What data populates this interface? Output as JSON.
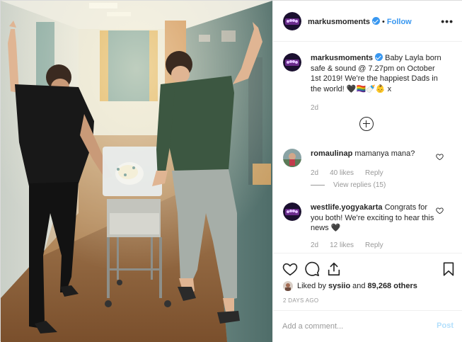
{
  "post": {
    "username": "markusmoments",
    "follow_label": "Follow",
    "more_label": "•••",
    "dot": "•",
    "caption": "Baby Layla born safe & sound @ 7.27pm on October 1st 2019! We're the happiest Dads in the world! 🖤🏳️‍🌈🍼👶 x",
    "caption_time": "2d"
  },
  "comments": [
    {
      "username": "romaulinap",
      "text": "mamanya mana?",
      "time": "2d",
      "likes": "40 likes",
      "reply_label": "Reply",
      "view_replies": "View replies (15)"
    },
    {
      "username": "westlife.yogyakarta",
      "text": "Congrats for you both! We're exciting to hear this news 🖤",
      "time": "2d",
      "likes": "12 likes",
      "reply_label": "Reply"
    }
  ],
  "actions": {
    "liked_prefix": "Liked by",
    "liked_user": "sysiio",
    "liked_and": "and",
    "liked_count": "89,268 others",
    "posted_ago": "2 DAYS AGO"
  },
  "add_comment": {
    "placeholder": "Add a comment...",
    "post_label": "Post"
  },
  "colors": {
    "link_blue": "#3897f0",
    "post_disabled": "#b2dffc",
    "muted": "#999999",
    "avatar_purple": "#6a2c8c"
  },
  "icons": [
    "verified-badge-icon",
    "more-options-icon",
    "plus-circle-icon",
    "heart-icon",
    "comment-icon",
    "share-icon",
    "bookmark-icon"
  ]
}
